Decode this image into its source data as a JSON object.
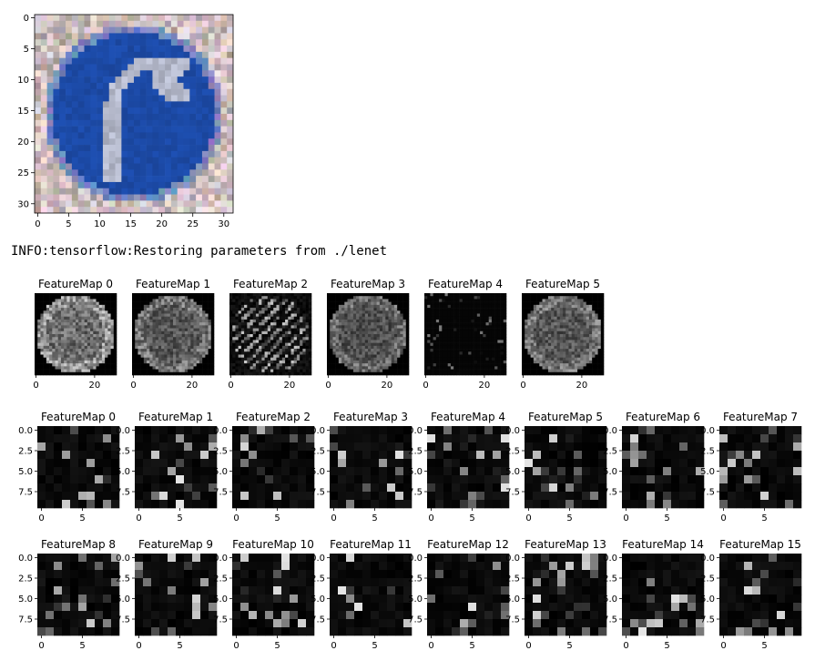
{
  "log": {
    "message": "INFO:tensorflow:Restoring parameters from ./lenet"
  },
  "input_image": {
    "x_ticks": [
      "0",
      "5",
      "10",
      "15",
      "20",
      "25",
      "30"
    ],
    "y_ticks": [
      "0",
      "5",
      "10",
      "15",
      "20",
      "25",
      "30"
    ],
    "content": "traffic sign: white right-turn arrow on blue circle"
  },
  "chart_data": [
    {
      "type": "heatmap",
      "name": "conv1",
      "resolution": [
        28,
        28
      ],
      "x_ticks": [
        "0",
        "20"
      ],
      "y_ticks": [],
      "panels": [
        "FeatureMap 0",
        "FeatureMap 1",
        "FeatureMap 2",
        "FeatureMap 3",
        "FeatureMap 4",
        "FeatureMap 5"
      ]
    },
    {
      "type": "heatmap",
      "name": "conv2-row1",
      "resolution": [
        10,
        10
      ],
      "x_ticks": [
        "0",
        "5"
      ],
      "y_ticks": [
        "0.0",
        "2.5",
        "5.0",
        "7.5"
      ],
      "panels": [
        "FeatureMap 0",
        "FeatureMap 1",
        "FeatureMap 2",
        "FeatureMap 3",
        "FeatureMap 4",
        "FeatureMap 5",
        "FeatureMap 6",
        "FeatureMap 7"
      ]
    },
    {
      "type": "heatmap",
      "name": "conv2-row2",
      "resolution": [
        10,
        10
      ],
      "x_ticks": [
        "0",
        "5"
      ],
      "y_ticks": [
        "0.0",
        "2.5",
        "5.0",
        "7.5"
      ],
      "panels": [
        "FeatureMap 8",
        "FeatureMap 9",
        "FeatureMap 10",
        "FeatureMap 11",
        "FeatureMap 12",
        "FeatureMap 13",
        "FeatureMap 14",
        "FeatureMap 15"
      ]
    }
  ],
  "colors": {
    "sign_blue": "#1f4fb0",
    "arrow_white": "#e8e8f0",
    "background_noise": "#c8b8b0",
    "map_black": "#000000"
  }
}
